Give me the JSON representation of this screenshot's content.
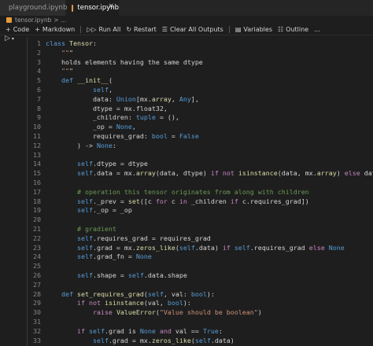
{
  "tabs": [
    {
      "label": "playground.ipynb",
      "active": false
    },
    {
      "label": "tensor.ipynb",
      "active": true
    }
  ],
  "breadcrumb": {
    "file": "tensor.ipynb",
    "rest": "> ..."
  },
  "toolbar": {
    "code": "Code",
    "markdown": "Markdown",
    "run_all": "Run All",
    "restart": "Restart",
    "clear_outputs": "Clear All Outputs",
    "variables": "Variables",
    "outline": "Outline",
    "more": "..."
  },
  "code_lines": [
    {
      "n": "1",
      "text": "class Tensor:"
    },
    {
      "n": "2",
      "text": "    \"\"\""
    },
    {
      "n": "3",
      "text": "    holds elements having the same dtype"
    },
    {
      "n": "4",
      "text": "    \"\"\""
    },
    {
      "n": "5",
      "text": "    def __init__("
    },
    {
      "n": "6",
      "text": "            self,"
    },
    {
      "n": "7",
      "text": "            data: Union[mx.array, Any],"
    },
    {
      "n": "8",
      "text": "            dtype = mx.float32,"
    },
    {
      "n": "9",
      "text": "            _children: tuple = (),"
    },
    {
      "n": "10",
      "text": "            _op = None,"
    },
    {
      "n": "11",
      "text": "            requires_grad: bool = False"
    },
    {
      "n": "12",
      "text": "        ) -> None:"
    },
    {
      "n": "13",
      "text": ""
    },
    {
      "n": "14",
      "text": "        self.dtype = dtype"
    },
    {
      "n": "15",
      "text": "        self.data = mx.array(data, dtype) if not isinstance(data, mx.array) else data"
    },
    {
      "n": "16",
      "text": ""
    },
    {
      "n": "17",
      "text": "        # operation this tensor originates from along with children"
    },
    {
      "n": "18",
      "text": "        self._prev = set([c for c in _children if c.requires_grad])"
    },
    {
      "n": "19",
      "text": "        self._op = _op"
    },
    {
      "n": "20",
      "text": ""
    },
    {
      "n": "21",
      "text": "        # gradient"
    },
    {
      "n": "22",
      "text": "        self.requires_grad = requires_grad"
    },
    {
      "n": "23",
      "text": "        self.grad = mx.zeros_like(self.data) if self.requires_grad else None"
    },
    {
      "n": "24",
      "text": "        self.grad_fn = None"
    },
    {
      "n": "25",
      "text": ""
    },
    {
      "n": "26",
      "text": "        self.shape = self.data.shape"
    },
    {
      "n": "27",
      "text": ""
    },
    {
      "n": "28",
      "text": "    def set_requires_grad(self, val: bool):"
    },
    {
      "n": "29",
      "text": "        if not isinstance(val, bool):"
    },
    {
      "n": "30",
      "text": "            raise ValueError(\"Value should be boolean\")"
    },
    {
      "n": "31",
      "text": ""
    },
    {
      "n": "32",
      "text": "        if self.grad is None and val == True:"
    },
    {
      "n": "33",
      "text": "            self.grad = mx.zeros_like(self.data)"
    }
  ]
}
